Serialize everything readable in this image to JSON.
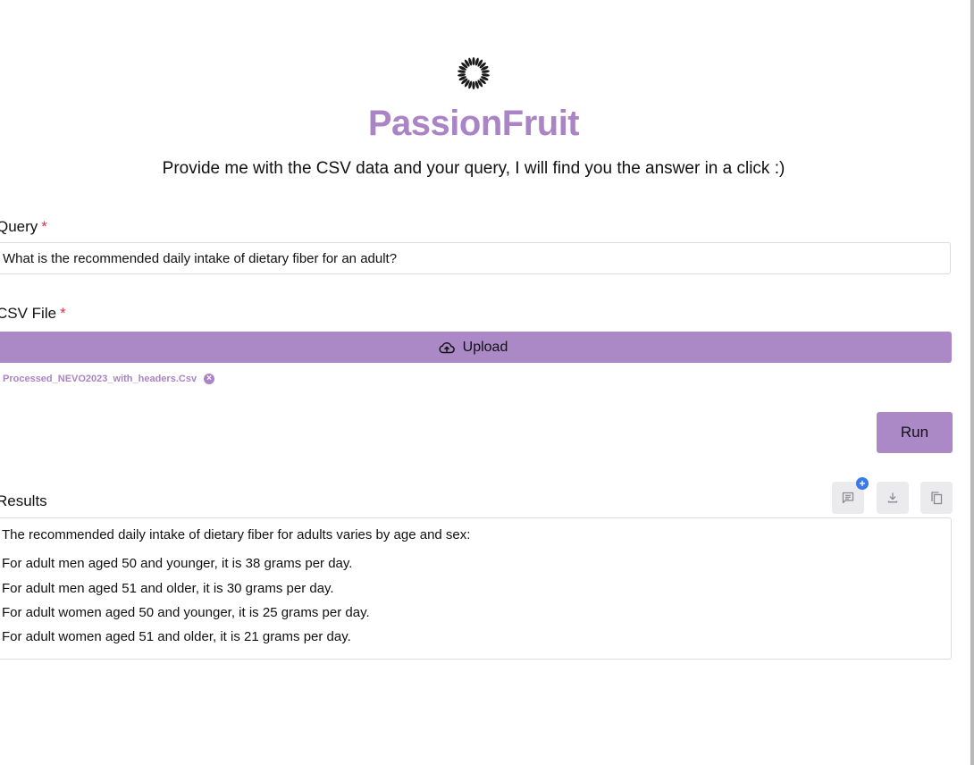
{
  "app": {
    "title": "PassionFruit",
    "subtitle": "Provide me with the CSV data and your query, I will find you the answer in a click :)",
    "logo_icon": "sunburst-logo-icon",
    "accent_color": "#ab84c6",
    "button_color": "#ab89c7"
  },
  "query": {
    "label": "Query",
    "required_mark": "*",
    "value": "What is the recommended daily intake of dietary fiber for an adult?"
  },
  "csv_file": {
    "label": "CSV File",
    "required_mark": "*",
    "upload_label": "Upload",
    "upload_icon": "cloud-upload-icon",
    "file_name": "Processed_NEVO2023_with_headers.Csv",
    "remove_icon": "remove-file-icon"
  },
  "run": {
    "label": "Run"
  },
  "results": {
    "label": "Results",
    "toolbar": {
      "feedback_icon": "comment-icon",
      "feedback_badge": "+",
      "download_icon": "download-icon",
      "copy_icon": "copy-icon"
    },
    "lines": [
      "The recommended daily intake of dietary fiber for adults varies by age and sex:",
      "For adult men aged 50 and younger, it is 38 grams per day.",
      "For adult men aged 51 and older, it is 30 grams per day.",
      "For adult women aged 50 and younger, it is 25 grams per day.",
      "For adult women aged 51 and older, it is 21 grams per day."
    ]
  }
}
